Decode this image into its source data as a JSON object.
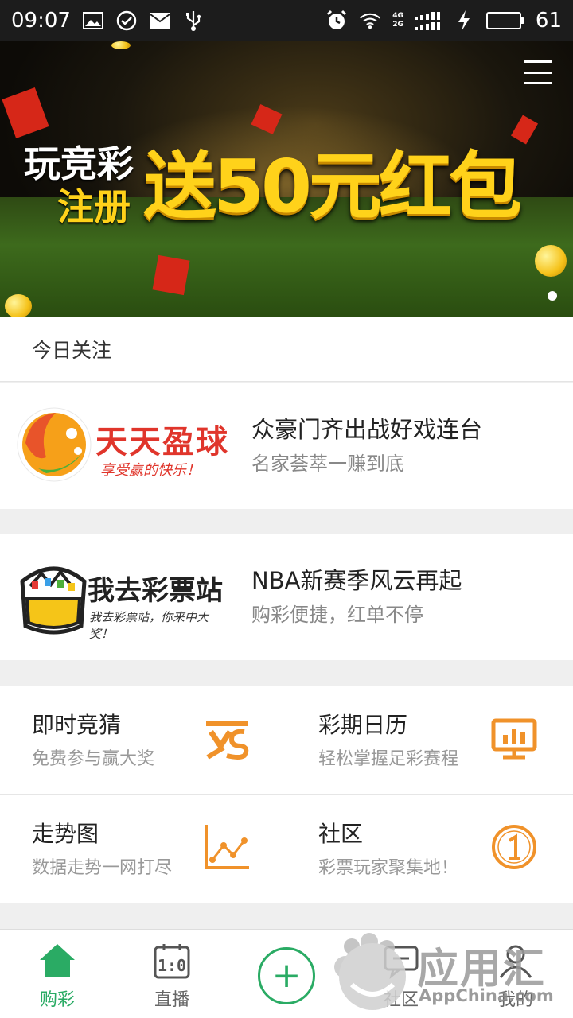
{
  "status_bar": {
    "time": "09:07",
    "battery": "61",
    "icons_left": [
      "image-icon",
      "check-circle-icon",
      "mail-icon",
      "usb-icon"
    ],
    "icons_right": [
      "alarm-icon",
      "wifi-icon",
      "signal-icon",
      "charging-icon",
      "battery-icon"
    ],
    "network_top": "4G",
    "network_bottom": "2G"
  },
  "banner": {
    "line1": "玩竞彩",
    "line2": "注册",
    "headline": "送50元红包"
  },
  "section": {
    "title": "今日关注"
  },
  "promos": [
    {
      "logo_title": "天天盈球",
      "logo_slogan": "享受赢的快乐！",
      "title": "众豪门齐出战好戏连台",
      "subtitle": "名家荟萃一赚到底"
    },
    {
      "logo_title": "我去彩票站",
      "logo_slogan": "我去彩票站，你来中大奖！",
      "title": "NBA新赛季风云再起",
      "subtitle": "购彩便捷，红单不停"
    }
  ],
  "grid": [
    {
      "title": "即时竞猜",
      "subtitle": "免费参与赢大奖",
      "icon": "versus-icon"
    },
    {
      "title": "彩期日历",
      "subtitle": "轻松掌握足彩赛程",
      "icon": "calendar-chart-icon"
    },
    {
      "title": "走势图",
      "subtitle": "数据走势一网打尽",
      "icon": "trend-chart-icon"
    },
    {
      "title": "社区",
      "subtitle": "彩票玩家聚集地！",
      "icon": "community-icon"
    }
  ],
  "tabbar": {
    "tabs": [
      {
        "label": "购彩",
        "icon": "home-icon",
        "active": true
      },
      {
        "label": "直播",
        "icon": "scoreboard-icon"
      },
      {
        "label": "",
        "icon": "plus-icon"
      },
      {
        "label": "社区",
        "icon": "chat-icon"
      },
      {
        "label": "我的",
        "icon": "user-icon"
      }
    ]
  },
  "watermark": {
    "text_big": "应用汇",
    "text_small": "AppChina.com"
  },
  "colors": {
    "accent_green": "#2aab64",
    "icon_orange": "#f0922a",
    "banner_gold": "#ffd21a"
  }
}
